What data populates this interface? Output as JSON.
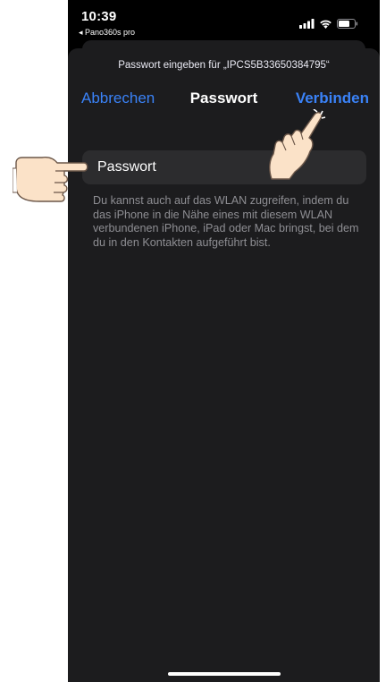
{
  "status_bar": {
    "time": "10:39",
    "back_app": "◂ Pano360s pro",
    "icons": [
      "cellular-signal-icon",
      "wifi-icon",
      "battery-icon"
    ]
  },
  "sheet": {
    "prompt": "Passwort eingeben für „IPCS5B33650384795“",
    "nav": {
      "cancel_label": "Abbrechen",
      "title": "Passwort",
      "connect_label": "Verbinden"
    },
    "password_field": {
      "placeholder": "Passwort",
      "value": ""
    },
    "hint": "Du kannst auch auf das WLAN zugreifen, indem du das iPhone in die Nähe eines mit diesem WLAN verbundenen iPhone, iPad oder Mac bringst, bei dem du in den Kontakten aufgeführt bist."
  },
  "colors": {
    "background": "#000000",
    "sheet": "#1c1c1e",
    "field": "#2c2c2e",
    "accent": "#3a82f7",
    "hint_text": "#8e8e93"
  },
  "annotations": [
    "pointing-hand-left",
    "pointing-hand-tapping-connect"
  ]
}
